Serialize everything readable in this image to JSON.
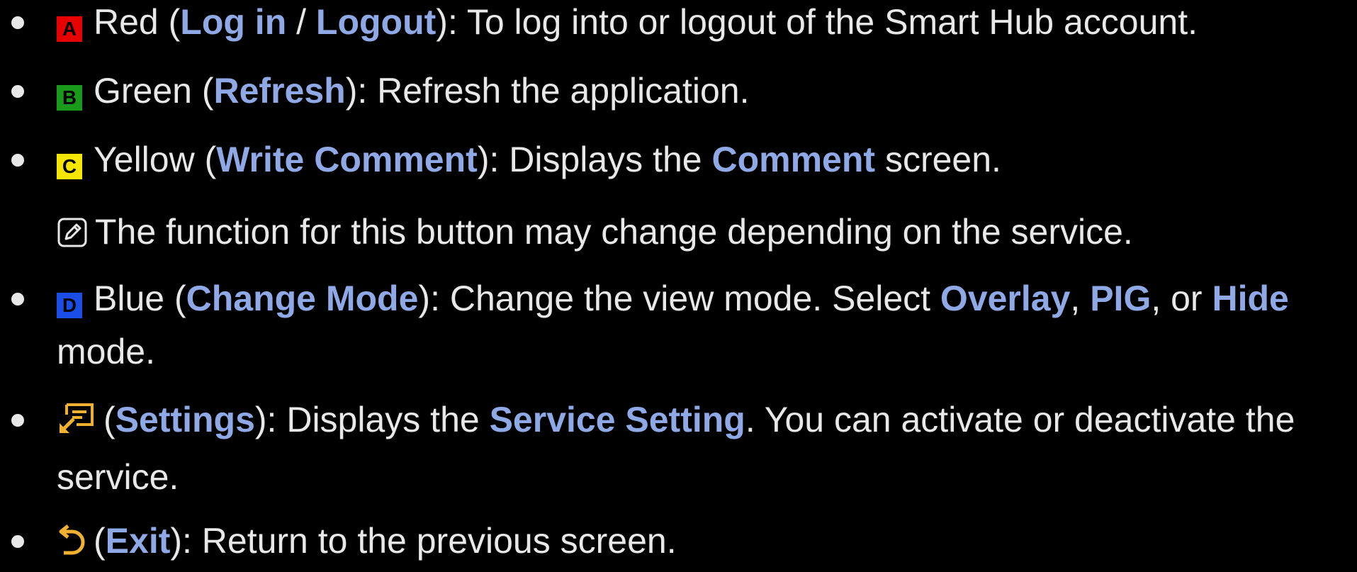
{
  "items": [
    {
      "key": "A",
      "color_name": "Red",
      "func": "Log in",
      "sep": " / ",
      "func2": "Logout",
      "desc": "): To log into or logout of the Smart Hub account."
    },
    {
      "key": "B",
      "color_name": "Green",
      "func": "Refresh",
      "desc": "): Refresh the application."
    },
    {
      "key": "C",
      "color_name": "Yellow",
      "func": "Write Comment",
      "desc": "): Displays the ",
      "hl2": "Comment",
      "desc2": " screen."
    },
    {
      "key": "D",
      "color_name": "Blue",
      "func": "Change Mode",
      "desc": "): Change the view mode. Select ",
      "hl2": "Overlay",
      "c1": ", ",
      "hl3": "PIG",
      "c2": ", or ",
      "hl4": "Hide",
      "desc2": " mode."
    },
    {
      "func": "Settings",
      "desc": "): Displays the ",
      "hl2": "Service Setting",
      "desc2": ". You can activate or deactivate the service."
    },
    {
      "func": "Exit",
      "desc": "): Return to the previous screen."
    }
  ],
  "note": "The function for this button may change depending on the service.",
  "colors": {
    "red": "#e80000",
    "green": "#1a9a1a",
    "yellow": "#f5e600",
    "blue": "#1a4ee6",
    "highlight": "#8fa9e6",
    "icon_orange": "#f0b030"
  }
}
